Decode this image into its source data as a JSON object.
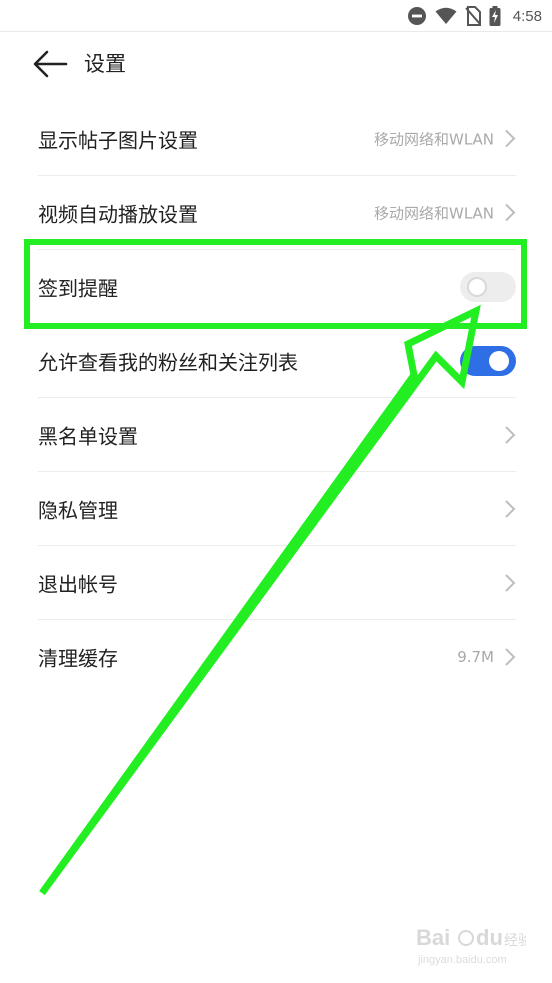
{
  "status_bar": {
    "time": "4:58",
    "icons": [
      "do-not-disturb-icon",
      "wifi-icon",
      "no-sim-icon",
      "battery-charging-icon"
    ]
  },
  "header": {
    "back_icon": "back-arrow-icon",
    "title": "设置"
  },
  "settings": {
    "items": [
      {
        "label": "显示帖子图片设置",
        "value": "移动网络和WLAN",
        "control": "chevron"
      },
      {
        "label": "视频自动播放设置",
        "value": "移动网络和WLAN",
        "control": "chevron"
      },
      {
        "label": "签到提醒",
        "value": "",
        "control": "toggle",
        "toggle_on": false
      },
      {
        "label": "允许查看我的粉丝和关注列表",
        "value": "",
        "control": "toggle",
        "toggle_on": true
      },
      {
        "label": "黑名单设置",
        "value": "",
        "control": "chevron"
      },
      {
        "label": "隐私管理",
        "value": "",
        "control": "chevron"
      },
      {
        "label": "退出帐号",
        "value": "",
        "control": "chevron"
      },
      {
        "label": "清理缓存",
        "value": "9.7M",
        "control": "chevron"
      }
    ]
  },
  "annotation": {
    "highlight_color": "#22ee22",
    "highlighted_item": "签到提醒"
  },
  "watermark": {
    "brand": "Bai du 经验",
    "url": "jingyan.baidu.com"
  },
  "colors": {
    "toggle_on": "#2f6fe6",
    "toggle_off": "#ededed",
    "value_text": "#a9a9a9"
  }
}
